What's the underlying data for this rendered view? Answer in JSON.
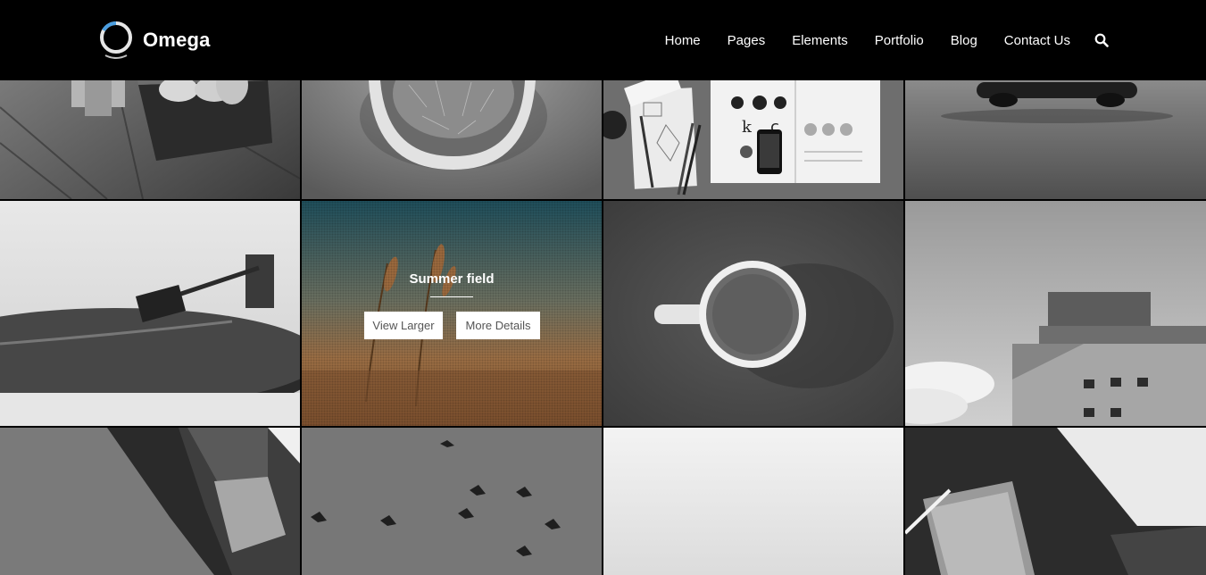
{
  "brand": {
    "name": "Omega"
  },
  "nav": {
    "items": [
      {
        "label": "Home"
      },
      {
        "label": "Pages"
      },
      {
        "label": "Elements"
      },
      {
        "label": "Portfolio"
      },
      {
        "label": "Blog"
      },
      {
        "label": "Contact Us"
      }
    ],
    "search_icon": "search-icon"
  },
  "colors": {
    "header_bg": "#000000",
    "logo_accent": "#4a9ee0",
    "overlay_button_bg": "#ffffff",
    "overlay_button_text": "#555555"
  },
  "gallery": {
    "hovered_item": {
      "title": "Summer field",
      "view_larger_label": "View Larger",
      "more_details_label": "More Details"
    }
  }
}
